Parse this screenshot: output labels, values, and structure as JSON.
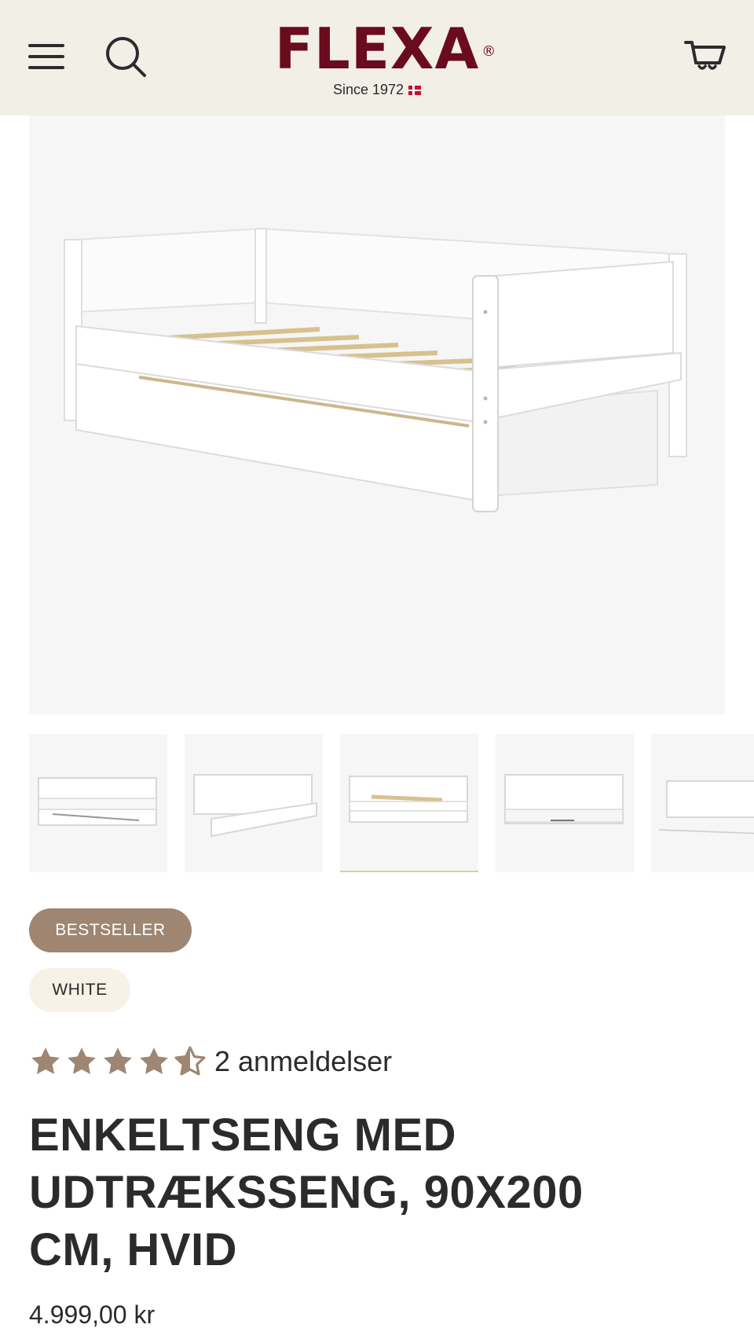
{
  "header": {
    "brand": "FLEXA",
    "brand_mark": "®",
    "tagline": "Since 1972",
    "icons": [
      "menu-icon",
      "search-icon",
      "cart-icon",
      "denmark-flag-icon"
    ],
    "background_color": "#f2efe7",
    "brand_color": "#6a0b1e"
  },
  "gallery": {
    "thumbnail_count": 5,
    "active_thumbnail_index": 2,
    "active_indicator_color": "#d9d08a"
  },
  "badges": {
    "bestseller": "BESTSELLER",
    "color_variant": "WHITE",
    "bestseller_color": "#9e8672"
  },
  "rating": {
    "score": 4.5,
    "max": 5,
    "reviews_text": "2 anmeldelser",
    "star_color": "#9e8672"
  },
  "product": {
    "title": "ENKELTSENG MED UDTRÆKSSENG, 90X200 CM, HVID",
    "price": "4.999,00 kr"
  }
}
